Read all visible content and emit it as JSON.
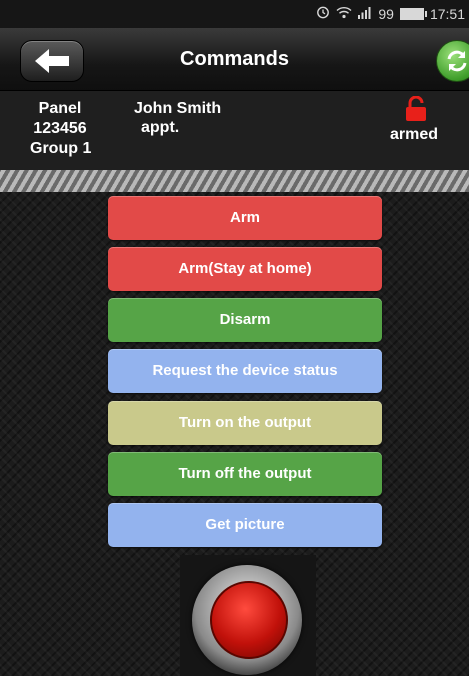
{
  "status_bar": {
    "alarm_icon": "alarm-clock-icon",
    "wifi_icon": "wifi-icon",
    "signal_icon": "signal-icon",
    "battery_level": "99",
    "time": "17:51"
  },
  "header": {
    "title": "Commands",
    "back_icon": "arrow-left-icon",
    "refresh_icon": "refresh-icon"
  },
  "panel": {
    "line1": "Panel",
    "line2": "123456",
    "line3": "Group 1"
  },
  "user": {
    "name": "John Smith",
    "unit": "appt."
  },
  "status": {
    "label": "armed",
    "icon": "lock-icon",
    "color": "#e8201a"
  },
  "commands": [
    {
      "label": "Arm",
      "color": "red"
    },
    {
      "label": "Arm(Stay at home)",
      "color": "red"
    },
    {
      "label": "Disarm",
      "color": "green"
    },
    {
      "label": "Request the device status",
      "color": "blue"
    },
    {
      "label": "Turn on the output",
      "color": "yellow"
    },
    {
      "label": "Turn off the output",
      "color": "green"
    },
    {
      "label": "Get picture",
      "color": "blue"
    }
  ],
  "panic_button": {
    "icon": "panic-button-icon"
  }
}
